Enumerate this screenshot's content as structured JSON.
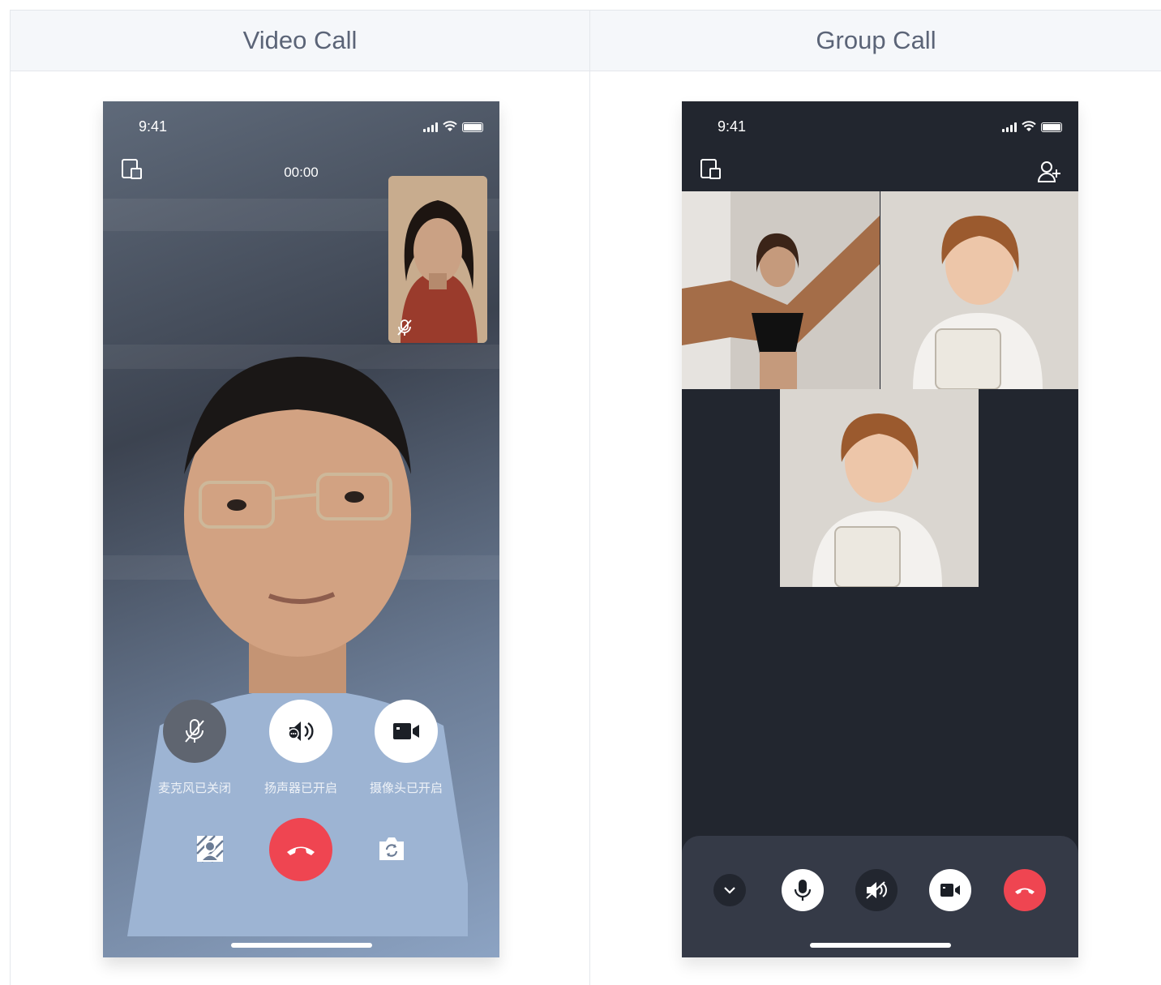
{
  "columns": [
    {
      "title": "Video Call"
    },
    {
      "title": "Group Call"
    }
  ],
  "video_call": {
    "status_time": "9:41",
    "timer": "00:00",
    "controls": [
      {
        "label": "麦克风已关闭"
      },
      {
        "label": "扬声器已开启"
      },
      {
        "label": "摄像头已开启"
      }
    ],
    "colors": {
      "hangup": "#ef4551",
      "mic_off_bg": "#5f6570",
      "control_bg": "#ffffff"
    }
  },
  "group_call": {
    "status_time": "9:41",
    "colors": {
      "background": "#22262f",
      "panel": "#353a47",
      "hangup": "#ef4551"
    }
  }
}
